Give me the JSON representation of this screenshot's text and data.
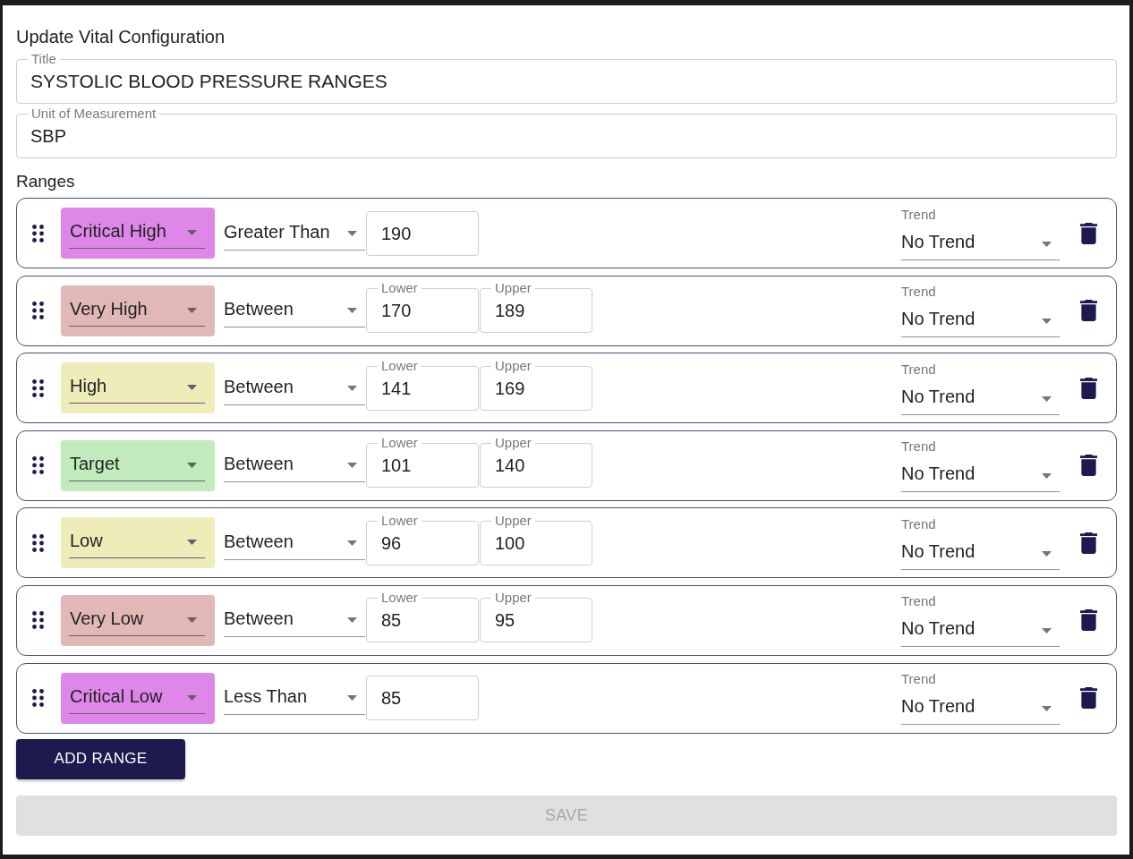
{
  "form": {
    "heading": "Update Vital Configuration"
  },
  "title_field": {
    "label": "Title",
    "value": "SYSTOLIC BLOOD PRESSURE RANGES"
  },
  "unit_field": {
    "label": "Unit of Measurement",
    "value": "SBP"
  },
  "ranges_heading": "Ranges",
  "ranges": [
    {
      "category": "Critical High",
      "color": "#df87e8",
      "operator": "Greater Than",
      "bounds": [
        {
          "value": "190"
        }
      ],
      "trend": {
        "label": "Trend",
        "value": "No Trend"
      }
    },
    {
      "category": "Very High",
      "color": "#e2b8b6",
      "operator": "Between",
      "bounds": [
        {
          "label": "Lower",
          "value": "170"
        },
        {
          "label": "Upper",
          "value": "189"
        }
      ],
      "trend": {
        "label": "Trend",
        "value": "No Trend"
      }
    },
    {
      "category": "High",
      "color": "#eeecb9",
      "operator": "Between",
      "bounds": [
        {
          "label": "Lower",
          "value": "141"
        },
        {
          "label": "Upper",
          "value": "169"
        }
      ],
      "trend": {
        "label": "Trend",
        "value": "No Trend"
      }
    },
    {
      "category": "Target",
      "color": "#c1eabd",
      "operator": "Between",
      "bounds": [
        {
          "label": "Lower",
          "value": "101"
        },
        {
          "label": "Upper",
          "value": "140"
        }
      ],
      "trend": {
        "label": "Trend",
        "value": "No Trend"
      }
    },
    {
      "category": "Low",
      "color": "#eeecb9",
      "operator": "Between",
      "bounds": [
        {
          "label": "Lower",
          "value": "96"
        },
        {
          "label": "Upper",
          "value": "100"
        }
      ],
      "trend": {
        "label": "Trend",
        "value": "No Trend"
      }
    },
    {
      "category": "Very Low",
      "color": "#e2b8b6",
      "operator": "Between",
      "bounds": [
        {
          "label": "Lower",
          "value": "85"
        },
        {
          "label": "Upper",
          "value": "95"
        }
      ],
      "trend": {
        "label": "Trend",
        "value": "No Trend"
      }
    },
    {
      "category": "Critical Low",
      "color": "#df87e8",
      "operator": "Less Than",
      "bounds": [
        {
          "value": "85"
        }
      ],
      "trend": {
        "label": "Trend",
        "value": "No Trend"
      }
    }
  ],
  "add_button": {
    "label": "ADD RANGE"
  },
  "save_button": {
    "label": "SAVE",
    "disabled": true
  }
}
